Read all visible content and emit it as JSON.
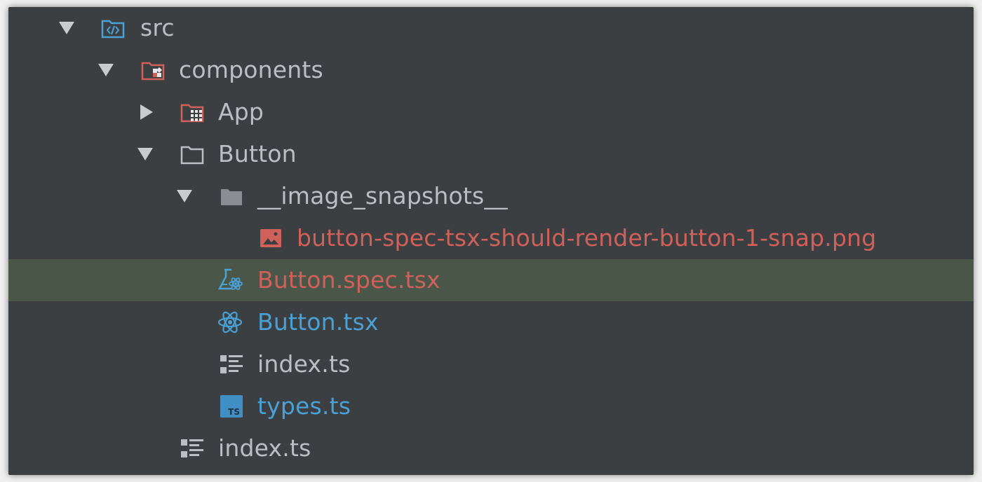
{
  "project_tree": {
    "nodes": [
      {
        "label": "src",
        "color": "normal",
        "icon": "source-folder-icon",
        "expanded": true
      },
      {
        "label": "components",
        "color": "normal",
        "icon": "components-folder-icon",
        "expanded": true
      },
      {
        "label": "App",
        "color": "normal",
        "icon": "app-folder-icon",
        "expanded": false
      },
      {
        "label": "Button",
        "color": "normal",
        "icon": "folder-icon",
        "expanded": true
      },
      {
        "label": "__image_snapshots__",
        "color": "normal",
        "icon": "snapshots-folder-icon",
        "expanded": true
      },
      {
        "label": "button-spec-tsx-should-render-button-1-snap.png",
        "color": "red",
        "icon": "image-file-icon"
      },
      {
        "label": "Button.spec.tsx",
        "color": "red",
        "icon": "test-react-file-icon",
        "selected": true
      },
      {
        "label": "Button.tsx",
        "color": "blue",
        "icon": "react-file-icon"
      },
      {
        "label": "index.ts",
        "color": "normal",
        "icon": "typescript-module-icon"
      },
      {
        "label": "types.ts",
        "color": "blue",
        "icon": "typescript-file-icon"
      },
      {
        "label": "index.ts",
        "color": "normal",
        "icon": "typescript-module-icon"
      }
    ]
  },
  "colors": {
    "background": "#3c3f41",
    "selection": "#4a5748",
    "text": "#bcbec4",
    "modified_red": "#d0605a",
    "added_blue": "#4aa1d6",
    "arrow": "#c9cbcf"
  }
}
